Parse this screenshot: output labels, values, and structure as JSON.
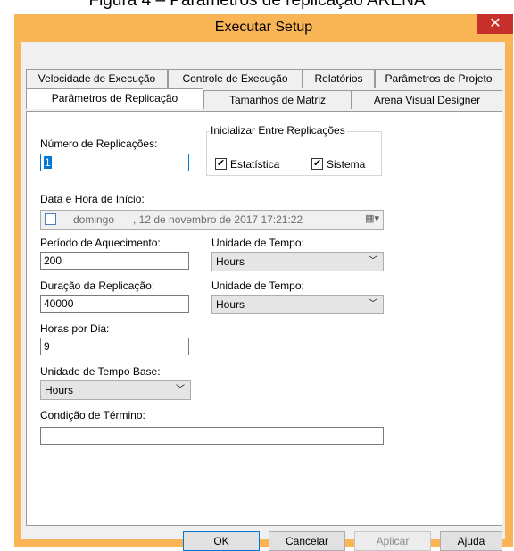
{
  "caption": "Figura 4 – Parâmetros de replicação ARENA",
  "window": {
    "title": "Executar Setup",
    "close_glyph": "✕",
    "colors": {
      "title_bar": "#f9b455",
      "close_button": "#c7302b",
      "client": "#f0f0f0"
    }
  },
  "tabs": {
    "row1": [
      "Velocidade de Execução",
      "Controle de Execução",
      "Relatórios",
      "Parâmetros de Projeto"
    ],
    "row2": [
      "Parâmetros de Replicação",
      "Tamanhos de Matriz",
      "Arena Visual Designer"
    ],
    "active": "Parâmetros de Replicação"
  },
  "form": {
    "num_replicacoes_label": "Número de Replicações:",
    "num_replicacoes_value": "1",
    "inicializar_group_label": "Inicializar Entre Replicações",
    "estatistica_label": "Estatística",
    "estatistica_checked": true,
    "sistema_label": "Sistema",
    "sistema_checked": true,
    "data_hora_label": "Data e Hora de Início:",
    "data_hora_day": "domingo",
    "data_hora_rest": ", 12 de novembro de 2017  17:21:22",
    "aquecimento_label": "Período de Aquecimento:",
    "aquecimento_value": "200",
    "unidade_tempo_label_1": "Unidade de Tempo:",
    "unidade_tempo_value_1": "Hours",
    "duracao_label": "Duração da Replicação:",
    "duracao_value": "40000",
    "unidade_tempo_label_2": "Unidade de Tempo:",
    "unidade_tempo_value_2": "Hours",
    "horas_dia_label": "Horas por Dia:",
    "horas_dia_value": "9",
    "unidade_base_label": "Unidade de Tempo Base:",
    "unidade_base_value": "Hours",
    "condicao_label": "Condição de Término:",
    "condicao_value": ""
  },
  "icons": {
    "checkmark": "✔",
    "chevron": "﹀",
    "calendar": "▦▾"
  },
  "buttons": {
    "ok": "OK",
    "cancelar": "Cancelar",
    "aplicar": "Aplicar",
    "ajuda": "Ajuda"
  }
}
